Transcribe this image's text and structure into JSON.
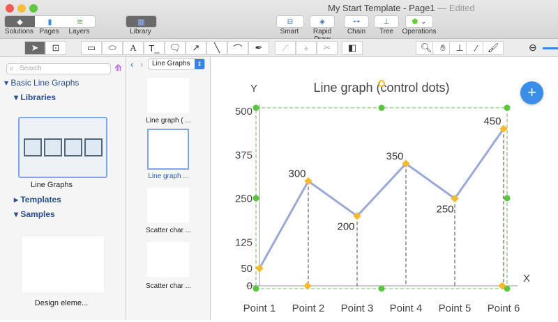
{
  "window": {
    "title": "My Start Template - Page1",
    "status": "— Edited"
  },
  "toolbar": {
    "segments": [
      {
        "label": "Solutions",
        "active": true
      },
      {
        "label": "Pages",
        "active": false
      },
      {
        "label": "Layers",
        "active": false
      }
    ],
    "library": "Library",
    "right_buttons": [
      "Smart",
      "Rapid Draw",
      "Chain",
      "Tree",
      "Operations"
    ]
  },
  "tools": [
    "pointer-icon",
    "text-box-icon",
    "rectangle-icon",
    "ellipse-icon",
    "text-icon",
    "text-block-icon",
    "callout-icon",
    "arrow-icon",
    "line-icon",
    "arc-icon",
    "pen-icon",
    "edit-path-icon",
    "add-point-icon",
    "cut-icon",
    "insert-icon",
    "zoom-icon",
    "hand-icon",
    "stamp-icon",
    "eyedropper-icon",
    "brush-icon",
    "zoom-out-icon"
  ],
  "left_panel": {
    "search_placeholder": "Search",
    "root": "Basic Line Graphs",
    "libraries": "Libraries",
    "library_item": "Line Graphs",
    "templates": "Templates",
    "samples": "Samples",
    "sample_item": "Design eleme..."
  },
  "mid_panel": {
    "selector": "Line Graphs",
    "items": [
      {
        "label": "Line graph ( ...",
        "selected": false
      },
      {
        "label": "Line graph  ...",
        "selected": true
      },
      {
        "label": "Scatter char ...",
        "selected": false
      },
      {
        "label": "Scatter char ...",
        "selected": false
      }
    ]
  },
  "add_button": "+",
  "chart_data": {
    "type": "line",
    "title": "Line graph (control dots)",
    "xlabel": "X",
    "ylabel": "Y",
    "categories": [
      "Point 1",
      "Point 2",
      "Point 3",
      "Point 4",
      "Point 5",
      "Point 6"
    ],
    "values": [
      50,
      300,
      200,
      350,
      250,
      450
    ],
    "data_labels": [
      "",
      "300",
      "200",
      "350",
      "250",
      "450"
    ],
    "yticks": [
      "0",
      "50",
      "125",
      "250",
      "375",
      "500"
    ],
    "ytick_values": [
      0,
      50,
      125,
      250,
      375,
      500
    ],
    "ylim": [
      0,
      500
    ],
    "line_color": "#9aa9d6",
    "marker_color": "#f5b92e",
    "handle_color": "#5cc441"
  }
}
